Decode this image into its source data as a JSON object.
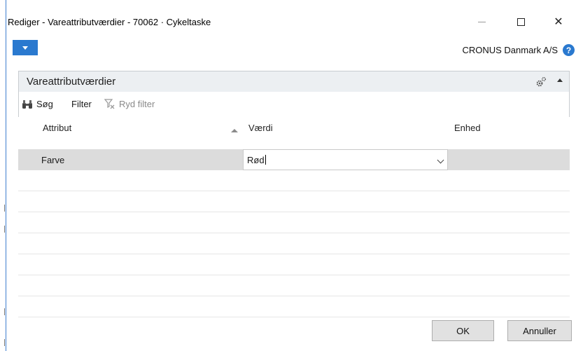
{
  "window": {
    "title": "Rediger - Vareattributværdier - 70062 · Cykeltaske",
    "minimize_icon": "minimize-icon",
    "maximize_icon": "maximize-icon",
    "close_icon": "close-icon",
    "close_glyph": "✕"
  },
  "ribbon": {
    "menu_icon": "dropdown-triangle-icon",
    "company": "CRONUS Danmark A/S",
    "help_icon": "help-icon",
    "help_glyph": "?",
    "accent": "#2a79cf"
  },
  "part": {
    "title": "Vareattributværdier",
    "gear_icon": "gear-icon",
    "collapse_icon": "collapse-icon"
  },
  "actions": {
    "search_label": "Søg",
    "search_icon": "binoculars-icon",
    "filter_label": "Filter",
    "clear_filter_label": "Ryd filter",
    "clear_filter_icon": "clear-filter-icon"
  },
  "table": {
    "columns": [
      "Attribut",
      "Værdi",
      "Enhed"
    ],
    "sort_icon": "sort-ascending-icon",
    "rows": [
      {
        "attribut": "Farve",
        "vaerdi": "Rød",
        "enhed": ""
      }
    ],
    "selected_row_color": "#dcdcdc"
  },
  "buttons": {
    "ok_label": "OK",
    "cancel_label": "Annuller"
  }
}
